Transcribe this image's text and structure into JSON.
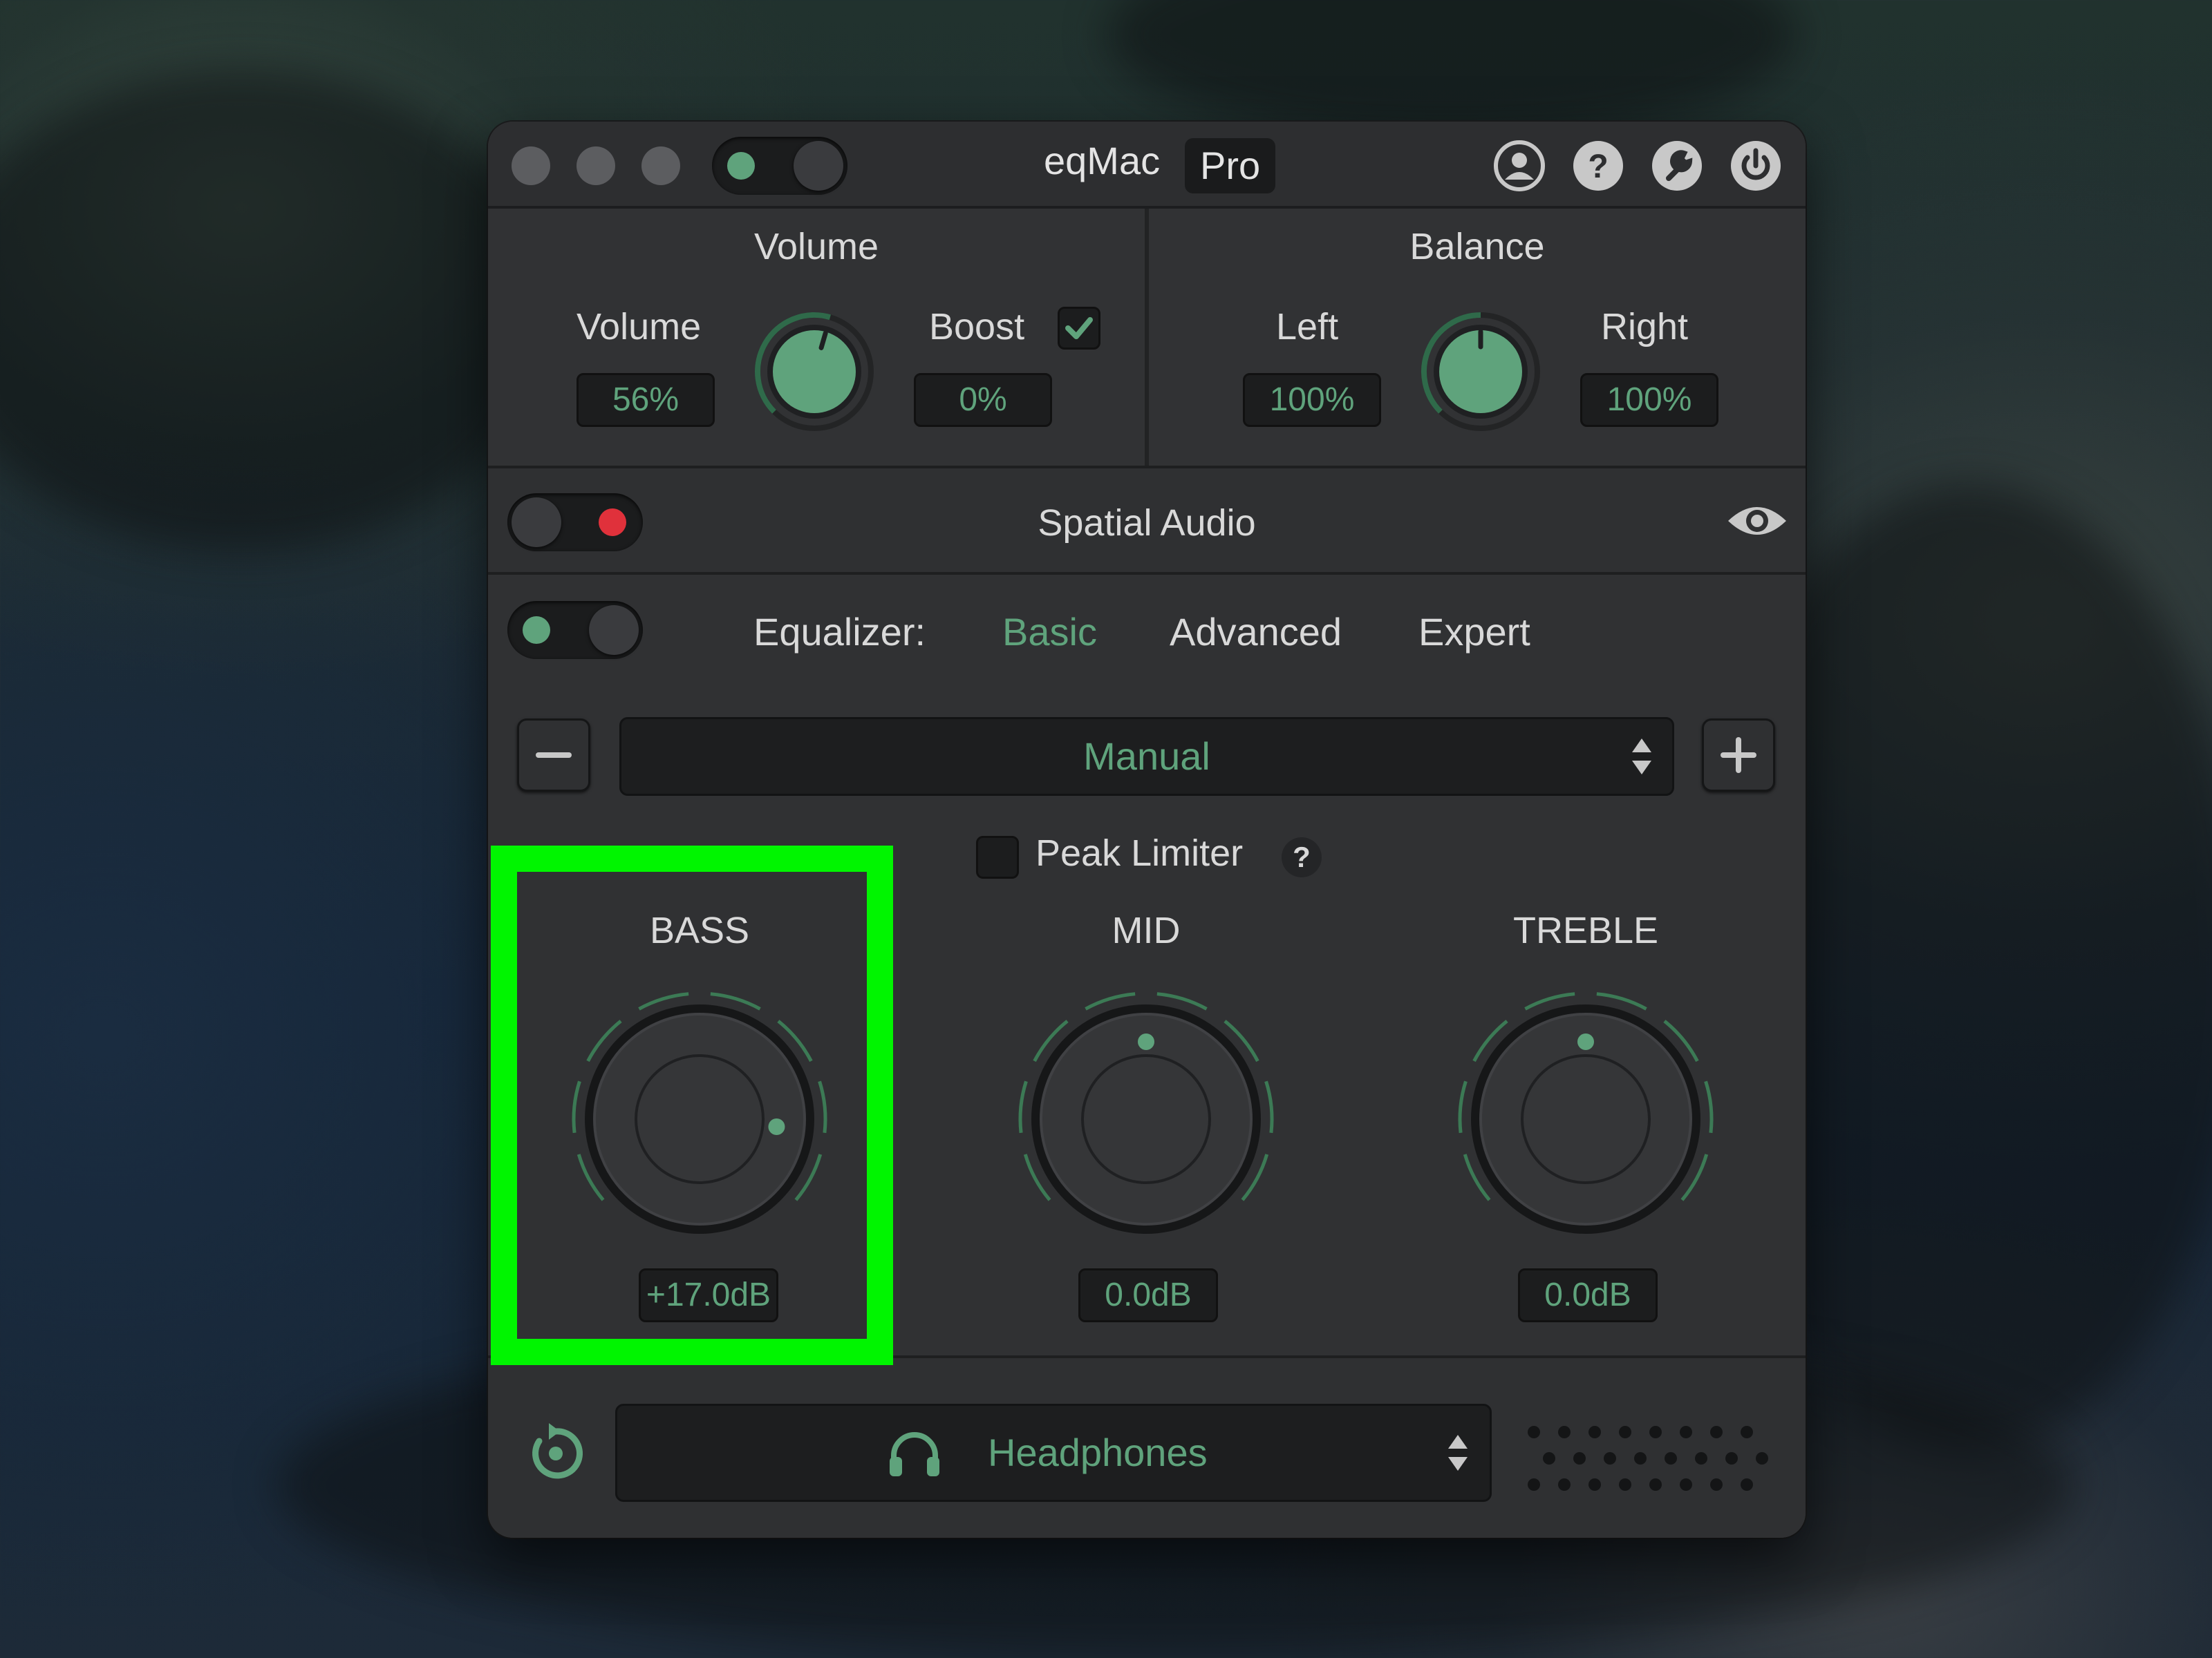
{
  "window": {
    "title": "eqMac",
    "badge": "Pro"
  },
  "volume_section": {
    "header": "Volume",
    "volume_label": "Volume",
    "volume_value": "56%",
    "volume_level": 0.56,
    "boost_label": "Boost",
    "boost_checked": true,
    "boost_value": "0%"
  },
  "balance_section": {
    "header": "Balance",
    "left_label": "Left",
    "left_value": "100%",
    "right_label": "Right",
    "right_value": "100%",
    "balance_level": 0.5
  },
  "spatial": {
    "label": "Spatial Audio",
    "enabled": false
  },
  "equalizer": {
    "label": "Equalizer:",
    "tabs": [
      "Basic",
      "Advanced",
      "Expert"
    ],
    "active_tab": "Basic",
    "enabled": true,
    "preset": "Manual",
    "peak_limiter_label": "Peak Limiter",
    "peak_limiter_help": "?",
    "bands": [
      {
        "name": "BASS",
        "value": "+17.0dB",
        "db": 17.0
      },
      {
        "name": "MID",
        "value": "0.0dB",
        "db": 0.0
      },
      {
        "name": "TREBLE",
        "value": "0.0dB",
        "db": 0.0
      }
    ]
  },
  "output": {
    "device": "Headphones"
  },
  "colors": {
    "accent": "#5fa37c",
    "highlight": "#00f500",
    "record_red": "#e0313b",
    "panel": "#303133"
  },
  "icons": [
    "account-icon",
    "help-icon",
    "settings-icon",
    "power-icon",
    "eye-icon",
    "minus-icon",
    "plus-icon",
    "stepper-icon",
    "reset-icon",
    "headphones-icon",
    "checkmark-icon"
  ]
}
